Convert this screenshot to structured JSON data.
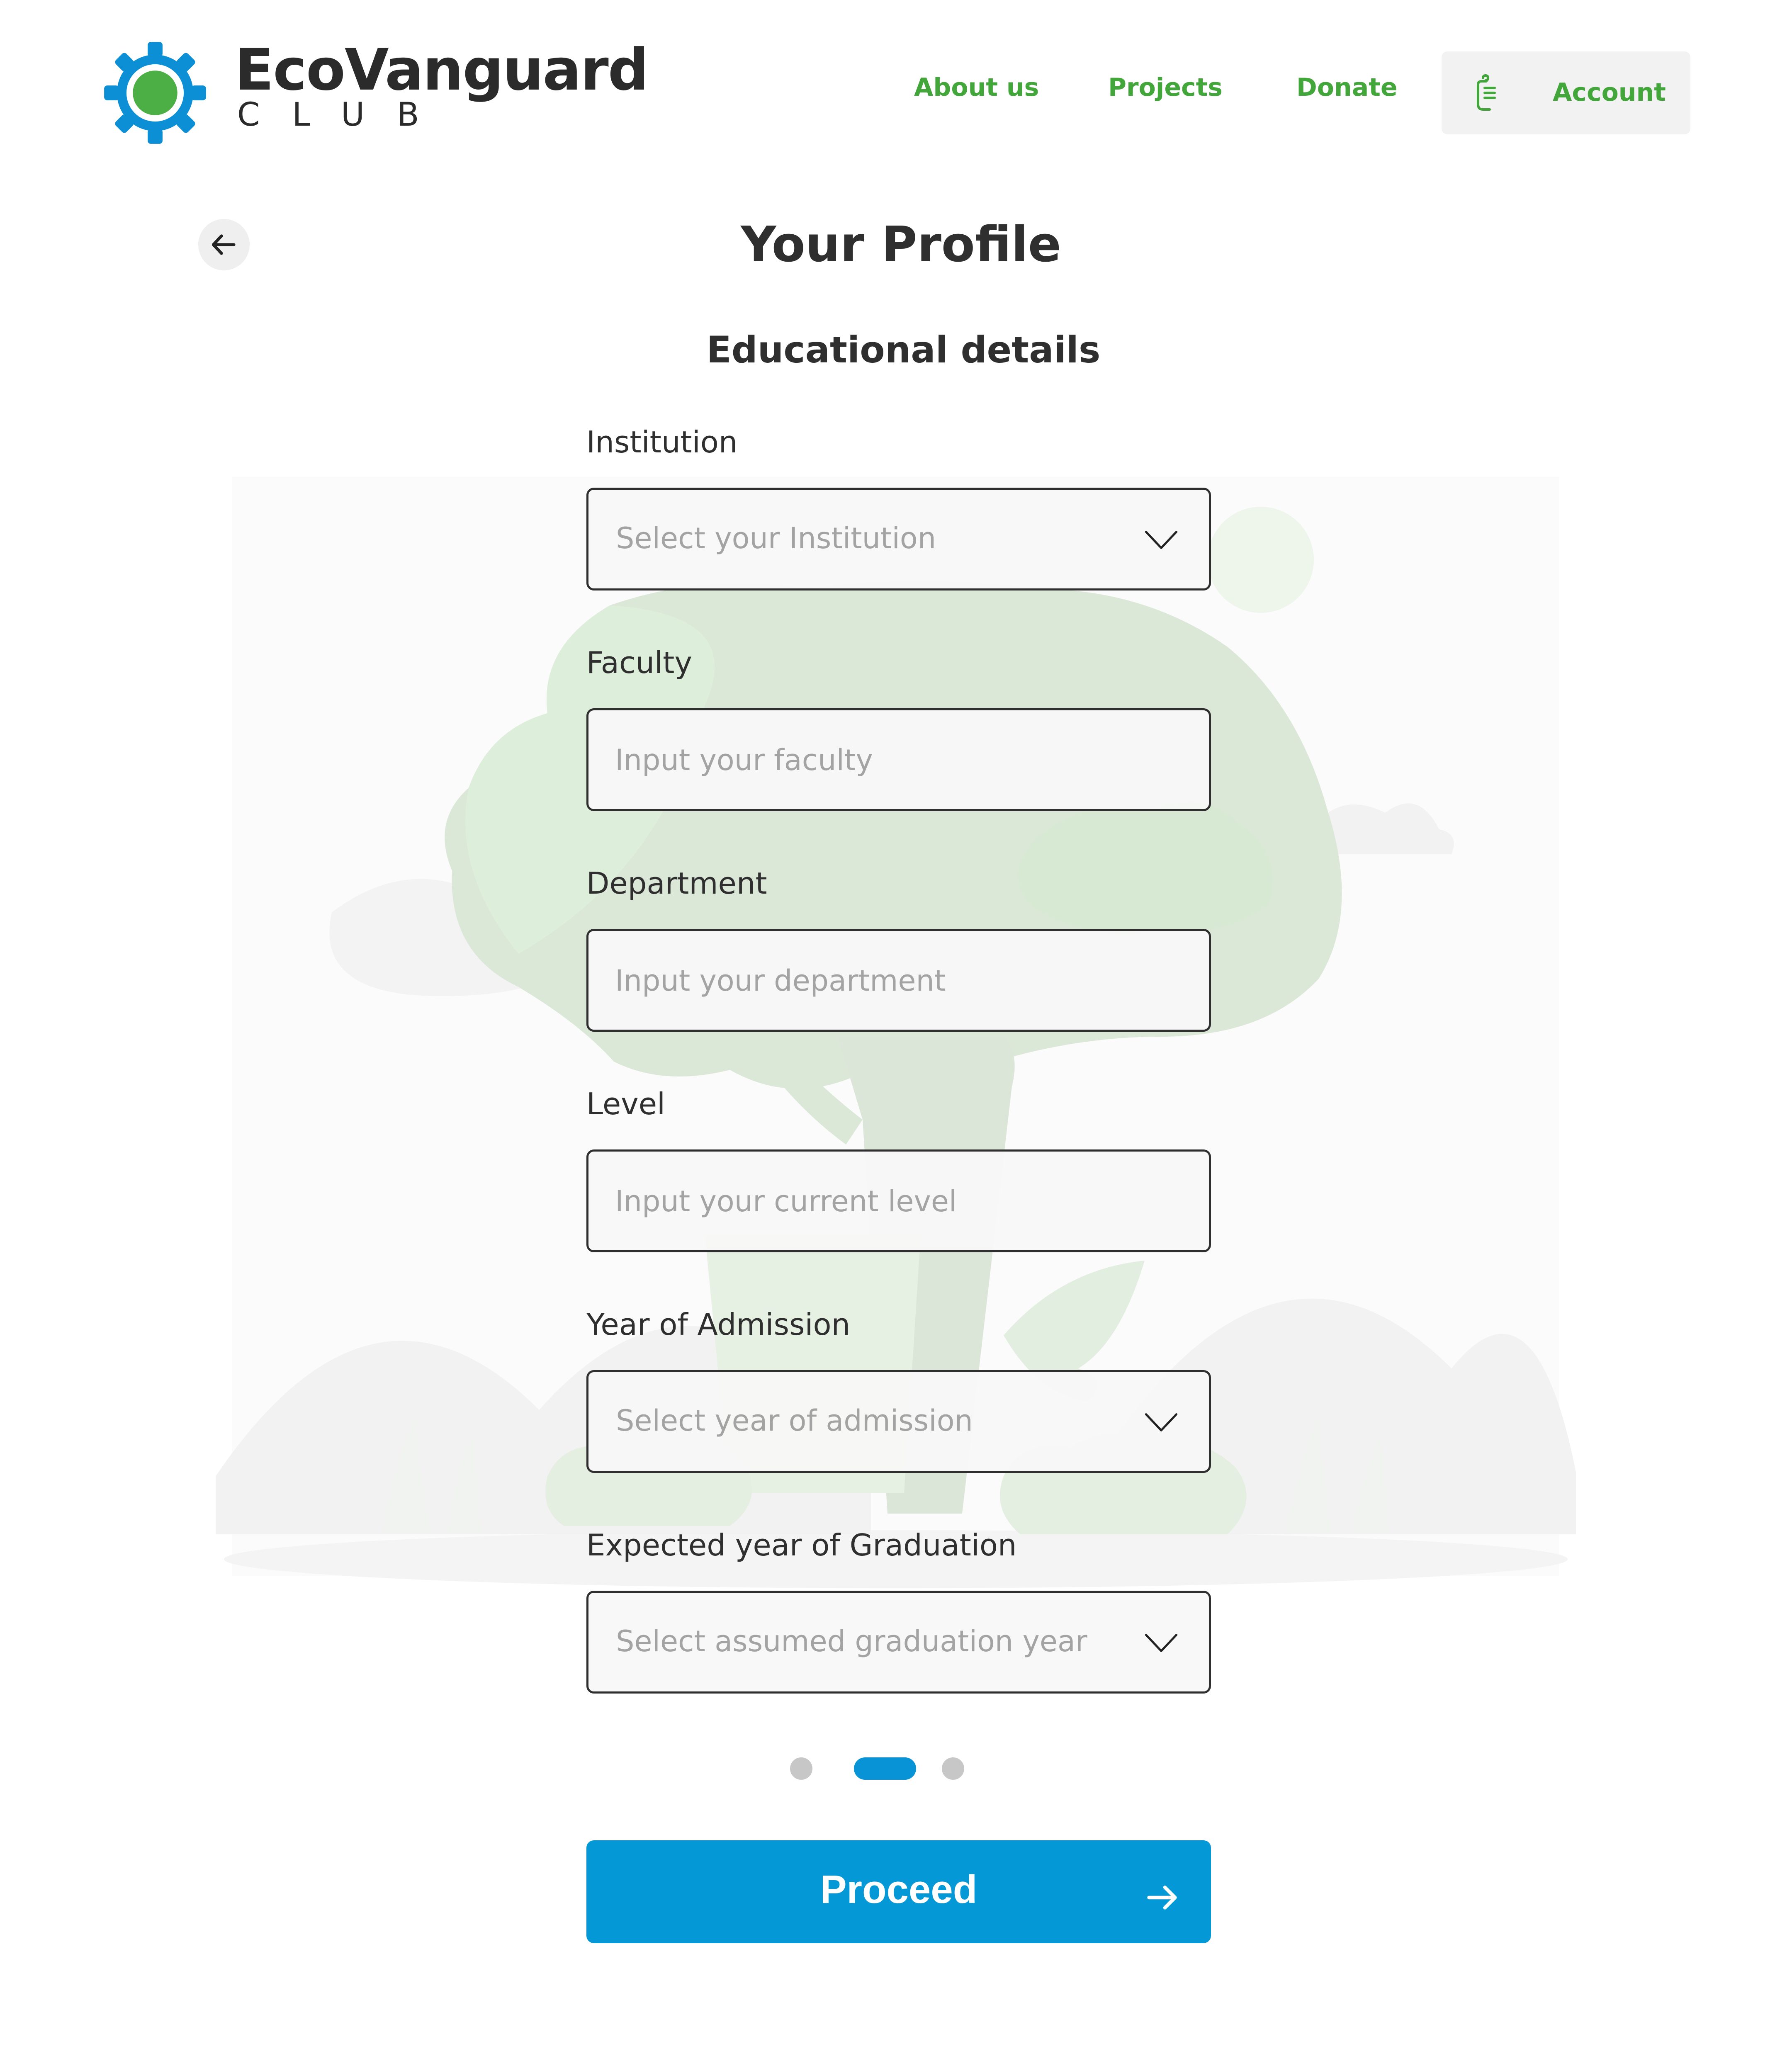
{
  "brand": {
    "name": "EcoVanguard",
    "subtitle": "CLUB"
  },
  "nav": {
    "links": [
      "About us",
      "Projects",
      "Donate"
    ],
    "account_label": "Account"
  },
  "page": {
    "title": "Your Profile",
    "section_title": "Educational details"
  },
  "form": {
    "institution": {
      "label": "Institution",
      "placeholder": "Select your Institution",
      "type": "select"
    },
    "faculty": {
      "label": "Faculty",
      "placeholder": "Input your faculty",
      "type": "input"
    },
    "department": {
      "label": "Department",
      "placeholder": "Input your department",
      "type": "input"
    },
    "level": {
      "label": "Level",
      "placeholder": "Input your current level",
      "type": "input"
    },
    "admission_year": {
      "label": "Year of Admission",
      "placeholder": "Select year of admission",
      "type": "select"
    },
    "graduation_year": {
      "label": "Expected year of Graduation",
      "placeholder": "Select assumed graduation year",
      "type": "select"
    }
  },
  "pagination": {
    "total_steps": 3,
    "current_step": 2
  },
  "actions": {
    "proceed_label": "Proceed"
  },
  "colors": {
    "brand_green": "#43a63b",
    "brand_blue": "#0598d6",
    "text_dark": "#2f2f2f",
    "placeholder": "#a3a3a3"
  },
  "icons": {
    "logo": "gear-logo-icon",
    "account": "account-icon",
    "back": "arrow-left-icon",
    "dropdown": "chevron-down-icon",
    "proceed": "arrow-right-icon"
  }
}
